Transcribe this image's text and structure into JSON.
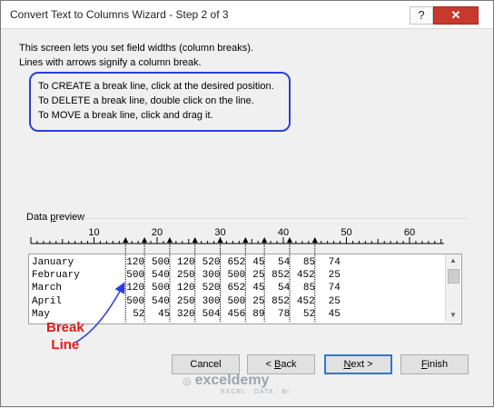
{
  "window": {
    "title": "Convert Text to Columns Wizard - Step 2 of 3",
    "help_icon": "?",
    "close_icon": "✕"
  },
  "intro": {
    "line1": "This screen lets you set field widths (column breaks).",
    "line2": "Lines with arrows signify a column break."
  },
  "instructions": {
    "create": "To CREATE a break line, click at the desired position.",
    "delete": "To DELETE a break line, double click on the line.",
    "move": "To MOVE a break line, click and drag it."
  },
  "preview": {
    "label_pre": "Data ",
    "label_accel": "p",
    "label_post": "review",
    "ruler_ticks": [
      "10",
      "20",
      "30",
      "40",
      "50",
      "60"
    ],
    "rows": [
      {
        "name": "January",
        "values": [
          "120",
          "500",
          "120",
          "520",
          "652",
          "45",
          "54",
          "85",
          "74"
        ]
      },
      {
        "name": "February",
        "values": [
          "500",
          "540",
          "250",
          "300",
          "500",
          "25",
          "852",
          "452",
          "25"
        ]
      },
      {
        "name": "March",
        "values": [
          "120",
          "500",
          "120",
          "520",
          "652",
          "45",
          "54",
          "85",
          "74"
        ]
      },
      {
        "name": "April",
        "values": [
          "500",
          "540",
          "250",
          "300",
          "500",
          "25",
          "852",
          "452",
          "25"
        ]
      },
      {
        "name": "May",
        "values": [
          "52",
          "45",
          "320",
          "504",
          "456",
          "89",
          "78",
          "52",
          "45"
        ]
      }
    ]
  },
  "annotation": {
    "line1": "Break",
    "line2": "Line"
  },
  "buttons": {
    "cancel": "Cancel",
    "back_pre": "< ",
    "back_accel": "B",
    "back_post": "ack",
    "next_accel": "N",
    "next_post": "ext >",
    "finish_accel": "F",
    "finish_post": "inish"
  },
  "watermark": {
    "brand": "exceldemy",
    "sub": "EXCEL · DATA · BI"
  },
  "colors": {
    "accent": "#2c3ee0",
    "annotation": "#e01b1b",
    "close": "#c7392c"
  }
}
